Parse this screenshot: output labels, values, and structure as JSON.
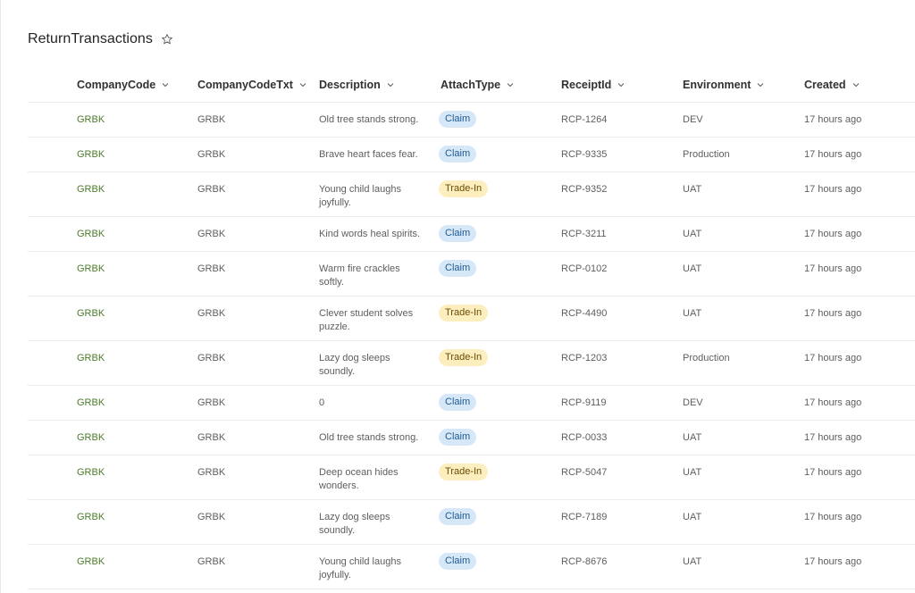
{
  "list": {
    "title": "ReturnTransactions",
    "favorite_icon": "star-outline-icon"
  },
  "columns": [
    {
      "label": "CompanyCode"
    },
    {
      "label": "CompanyCodeTxt"
    },
    {
      "label": "Description"
    },
    {
      "label": "AttachType"
    },
    {
      "label": "ReceiptId"
    },
    {
      "label": "Environment"
    },
    {
      "label": "Created"
    }
  ],
  "colors": {
    "link_text": "#4d7b2b",
    "claim_bg": "#d6e8f8",
    "claim_text": "#1f5a93",
    "tradein_bg": "#fdeec0",
    "tradein_text": "#6b4b00"
  },
  "rows": [
    {
      "company_code": "GRBK",
      "company_code_txt": "GRBK",
      "description": "Old tree stands strong.",
      "attach_type": "Claim",
      "receipt_id": "RCP-1264",
      "environment": "DEV",
      "created": "17 hours ago"
    },
    {
      "company_code": "GRBK",
      "company_code_txt": "GRBK",
      "description": "Brave heart faces fear.",
      "attach_type": "Claim",
      "receipt_id": "RCP-9335",
      "environment": "Production",
      "created": "17 hours ago"
    },
    {
      "company_code": "GRBK",
      "company_code_txt": "GRBK",
      "description": "Young child laughs joyfully.",
      "attach_type": "Trade-In",
      "receipt_id": "RCP-9352",
      "environment": "UAT",
      "created": "17 hours ago"
    },
    {
      "company_code": "GRBK",
      "company_code_txt": "GRBK",
      "description": "Kind words heal spirits.",
      "attach_type": "Claim",
      "receipt_id": "RCP-3211",
      "environment": "UAT",
      "created": "17 hours ago"
    },
    {
      "company_code": "GRBK",
      "company_code_txt": "GRBK",
      "description": "Warm fire crackles softly.",
      "attach_type": "Claim",
      "receipt_id": "RCP-0102",
      "environment": "UAT",
      "created": "17 hours ago"
    },
    {
      "company_code": "GRBK",
      "company_code_txt": "GRBK",
      "description": "Clever student solves puzzle.",
      "attach_type": "Trade-In",
      "receipt_id": "RCP-4490",
      "environment": "UAT",
      "created": "17 hours ago"
    },
    {
      "company_code": "GRBK",
      "company_code_txt": "GRBK",
      "description": "Lazy dog sleeps soundly.",
      "attach_type": "Trade-In",
      "receipt_id": "RCP-1203",
      "environment": "Production",
      "created": "17 hours ago"
    },
    {
      "company_code": "GRBK",
      "company_code_txt": "GRBK",
      "description": "0",
      "attach_type": "Claim",
      "receipt_id": "RCP-9119",
      "environment": "DEV",
      "created": "17 hours ago"
    },
    {
      "company_code": "GRBK",
      "company_code_txt": "GRBK",
      "description": "Old tree stands strong.",
      "attach_type": "Claim",
      "receipt_id": "RCP-0033",
      "environment": "UAT",
      "created": "17 hours ago"
    },
    {
      "company_code": "GRBK",
      "company_code_txt": "GRBK",
      "description": "Deep ocean hides wonders.",
      "attach_type": "Trade-In",
      "receipt_id": "RCP-5047",
      "environment": "UAT",
      "created": "17 hours ago"
    },
    {
      "company_code": "GRBK",
      "company_code_txt": "GRBK",
      "description": "Lazy dog sleeps soundly.",
      "attach_type": "Claim",
      "receipt_id": "RCP-7189",
      "environment": "UAT",
      "created": "17 hours ago"
    },
    {
      "company_code": "GRBK",
      "company_code_txt": "GRBK",
      "description": "Young child laughs joyfully.",
      "attach_type": "Claim",
      "receipt_id": "RCP-8676",
      "environment": "UAT",
      "created": "17 hours ago"
    }
  ]
}
